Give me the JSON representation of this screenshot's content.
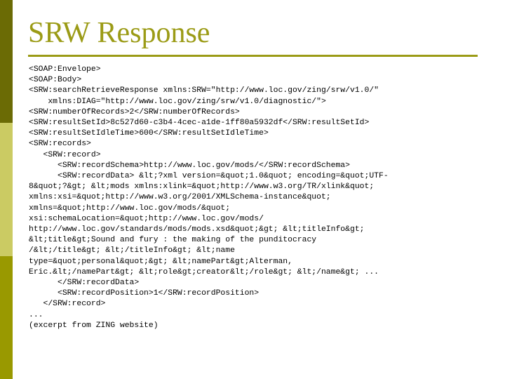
{
  "slide": {
    "title": "SRW Response",
    "title_color": "#9b9b16",
    "rule_color": "#9b9b16",
    "background_color": "#ffffff",
    "body_text_color": "#000000"
  },
  "sidebar": {
    "band_top_color": "#6b6b05",
    "band_middle_color": "#cbcb63",
    "band_bottom_color": "#999900",
    "bands": [
      {
        "name": "band-top",
        "color": "#6b6b05"
      },
      {
        "name": "band-middle",
        "color": "#cbcb63"
      },
      {
        "name": "band-bottom",
        "color": "#999900"
      }
    ]
  },
  "code": {
    "lines": [
      "<SOAP:Envelope>",
      "<SOAP:Body>",
      "<SRW:searchRetrieveResponse xmlns:SRW=\"http://www.loc.gov/zing/srw/v1.0/\"",
      "    xmlns:DIAG=\"http://www.loc.gov/zing/srw/v1.0/diagnostic/\">",
      "<SRW:numberOfRecords>2</SRW:numberOfRecords>",
      "<SRW:resultSetId>8c527d60-c3b4-4cec-a1de-1ff80a5932df</SRW:resultSetId>",
      "<SRW:resultSetIdleTime>600</SRW:resultSetIdleTime>",
      "<SRW:records>",
      "   <SRW:record>",
      "      <SRW:recordSchema>http://www.loc.gov/mods/</SRW:recordSchema>",
      "      <SRW:recordData> &lt;?xml version=&quot;1.0&quot; encoding=&quot;UTF-",
      "8&quot;?&gt; &lt;mods xmlns:xlink=&quot;http://www.w3.org/TR/xlink&quot;",
      "xmlns:xsi=&quot;http://www.w3.org/2001/XMLSchema-instance&quot;",
      "xmlns=&quot;http://www.loc.gov/mods/&quot;",
      "xsi:schemaLocation=&quot;http://www.loc.gov/mods/",
      "http://www.loc.gov/standards/mods/mods.xsd&quot;&gt; &lt;titleInfo&gt;",
      "&lt;title&gt;Sound and fury : the making of the punditocracy",
      "/&lt;/title&gt; &lt;/titleInfo&gt; &lt;name",
      "type=&quot;personal&quot;&gt; &lt;namePart&gt;Alterman,",
      "Eric.&lt;/namePart&gt; &lt;role&gt;creator&lt;/role&gt; &lt;/name&gt; ...",
      "      </SRW:recordData>",
      "      <SRW:recordPosition>1</SRW:recordPosition>",
      "   </SRW:record>",
      "...",
      "(excerpt from ZING website)"
    ]
  }
}
